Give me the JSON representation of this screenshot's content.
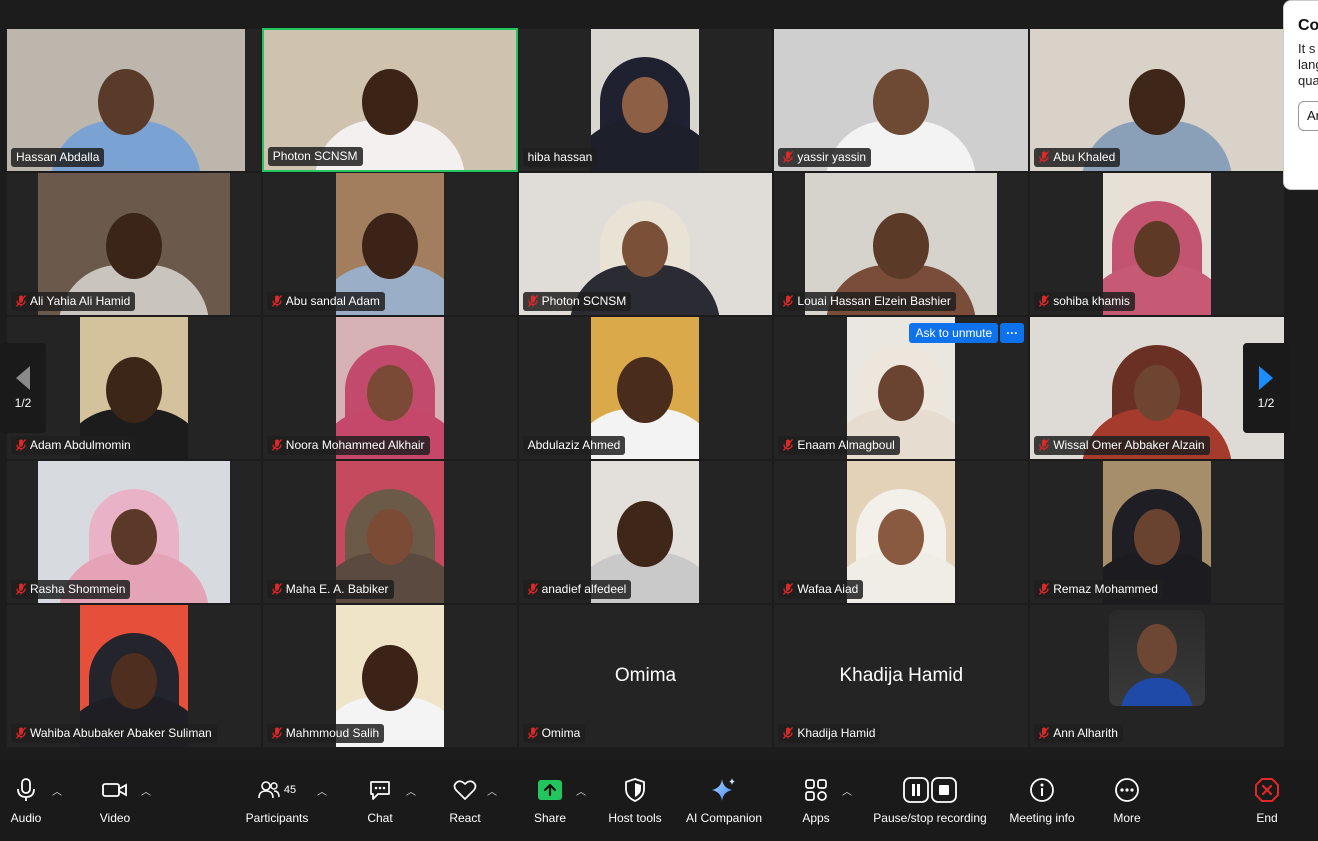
{
  "participants_grid": [
    {
      "name": "Hassan Abdalla",
      "muted": false,
      "bg": "#bcb6ad",
      "skin": "#5a3a28",
      "shirt": "#7aa3d4",
      "hijab": ""
    },
    {
      "name": "Photon SCNSM",
      "muted": false,
      "bg": "#cfc3b0",
      "skin": "#3b2416",
      "shirt": "#f5f0f0",
      "hijab": "",
      "active": true
    },
    {
      "name": "hiba hassan",
      "muted": false,
      "bg": "#d9d6d0",
      "skin": "#8d5f45",
      "shirt": "#1d1f2a",
      "hijab": "#1f2130"
    },
    {
      "name": "yassir yassin",
      "muted": true,
      "bg": "#cfcfcf",
      "skin": "#6e4a35",
      "shirt": "#f3f3f3",
      "hijab": ""
    },
    {
      "name": "Abu Khaled",
      "muted": true,
      "bg": "#d8d2c8",
      "skin": "#3e2618",
      "shirt": "#8aa0b8",
      "hijab": ""
    },
    {
      "name": "Ali Yahia Ali Hamid",
      "muted": true,
      "bg": "#6b5a4b",
      "skin": "#3a2518",
      "shirt": "#c9c4bd",
      "hijab": ""
    },
    {
      "name": "Abu sandal Adam",
      "muted": true,
      "bg": "#a27e5e",
      "skin": "#3b2417",
      "shirt": "#9aaec8",
      "hijab": ""
    },
    {
      "name": "Photon SCNSM",
      "muted": true,
      "bg": "#e0ddd8",
      "skin": "#7a5038",
      "shirt": "#2b2b33",
      "hijab": "#e9e3d6"
    },
    {
      "name": "Louai Hassan Elzein Bashier",
      "muted": true,
      "bg": "#d6d2cc",
      "skin": "#5b3b28",
      "shirt": "#7a4c3a",
      "hijab": ""
    },
    {
      "name": "sohiba khamis",
      "muted": true,
      "bg": "#e6e0d6",
      "skin": "#5e3a26",
      "shirt": "#c65a74",
      "hijab": "#c25470"
    },
    {
      "name": "Adam Abdulmomin",
      "muted": true,
      "bg": "#d4c29c",
      "skin": "#3b2618",
      "shirt": "#1c1c1c",
      "hijab": ""
    },
    {
      "name": "Noora Mohammed Alkhair",
      "muted": true,
      "bg": "#d7b2b4",
      "skin": "#7b4a36",
      "shirt": "#c5486a",
      "hijab": "#c24a6c"
    },
    {
      "name": "Abdulaziz Ahmed",
      "muted": false,
      "bg": "#d9a94a",
      "skin": "#4a2c1c",
      "shirt": "#f3f3f3",
      "hijab": ""
    },
    {
      "name": "Enaam Almagboul",
      "muted": true,
      "bg": "#eae6e0",
      "skin": "#6a4430",
      "shirt": "#e6ddd0",
      "hijab": "#ece6dc",
      "unmute": true
    },
    {
      "name": "Wissal Omer Abbaker Alzain",
      "muted": true,
      "bg": "#dedad6",
      "skin": "#6e4530",
      "shirt": "#a43b2d",
      "hijab": "#6b3024"
    },
    {
      "name": "Rasha Shommein",
      "muted": true,
      "bg": "#d7dbe0",
      "skin": "#5b3828",
      "shirt": "#e5a3b8",
      "hijab": "#eab2c6"
    },
    {
      "name": "Maha E. A. Babiker",
      "muted": true,
      "bg": "#c64a5e",
      "skin": "#7b4b36",
      "shirt": "#5a4a40",
      "hijab": "#6b5a48"
    },
    {
      "name": "anadief alfedeel",
      "muted": true,
      "bg": "#e3e0dc",
      "skin": "#3e2718",
      "shirt": "#c9c9c9",
      "hijab": ""
    },
    {
      "name": "Wafaa Aiad",
      "muted": true,
      "bg": "#e3d2b8",
      "skin": "#8a5a40",
      "shirt": "#f0ece6",
      "hijab": "#f3efe9"
    },
    {
      "name": "Remaz Mohammed",
      "muted": true,
      "bg": "#a78e6a",
      "skin": "#6a4330",
      "shirt": "#1c1c20",
      "hijab": "#1e1e24"
    },
    {
      "name": "Wahiba Abubaker Abaker Suliman",
      "muted": true,
      "bg": "#e6503a",
      "skin": "#4e2e1e",
      "shirt": "#1e1e24",
      "hijab": "#24242c"
    },
    {
      "name": "Mahmmoud Salih",
      "muted": true,
      "bg": "#efe4c8",
      "skin": "#3b2417",
      "shirt": "#f4f4f4",
      "hijab": ""
    },
    {
      "name": "Omima",
      "muted": true,
      "video_off": true,
      "big_name": "Omima"
    },
    {
      "name": "Khadija Hamid",
      "muted": true,
      "video_off": true,
      "big_name": "Khadija Hamid"
    },
    {
      "name": "Ann Alharith",
      "muted": true,
      "video_off": true,
      "photo": true
    }
  ],
  "unmute": {
    "ask_label": "Ask to unmute",
    "more_label": "···"
  },
  "pager": {
    "left_label": "1/2",
    "right_label": "1/2"
  },
  "popup": {
    "title": "Co",
    "lines": [
      "It s",
      "lang",
      "qua"
    ],
    "button_label": "Ar"
  },
  "toolbar": {
    "audio": "Audio",
    "video": "Video",
    "participants": "Participants",
    "participants_count": "45",
    "chat": "Chat",
    "react": "React",
    "share": "Share",
    "host_tools": "Host tools",
    "ai_companion": "AI Companion",
    "apps": "Apps",
    "pause_stop_recording": "Pause/stop recording",
    "meeting_info": "Meeting info",
    "more": "More",
    "end": "End"
  },
  "colors": {
    "accent_blue": "#0e72ed",
    "active_green": "#22c55e",
    "end_red": "#e02828",
    "share_green": "#22c55e"
  }
}
